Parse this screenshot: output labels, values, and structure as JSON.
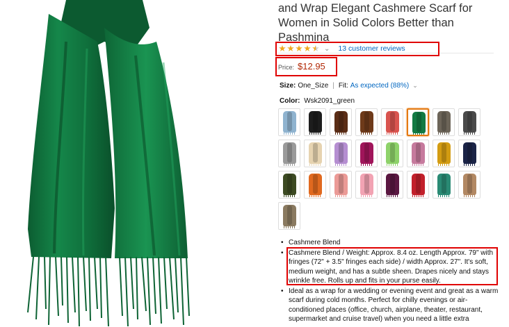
{
  "product": {
    "title": "and Wrap Elegant Cashmere Scarf for Women in Solid Colors Better than Pashmina",
    "rating": {
      "stars": 4.5,
      "reviews_link": "13 customer reviews"
    },
    "price": {
      "label": "Price:",
      "value": "$12.95"
    },
    "size": {
      "label": "Size:",
      "value": "One_Size",
      "fit_label": "Fit:",
      "fit_value": "As expected (88%)"
    },
    "color": {
      "label": "Color:",
      "value": "Wsk2091_green"
    },
    "swatches": [
      {
        "name": "light blue",
        "color": "#8fb3cf",
        "selected": false
      },
      {
        "name": "black",
        "color": "#1d1d1d",
        "selected": false
      },
      {
        "name": "brown",
        "color": "#5a2d16",
        "selected": false
      },
      {
        "name": "chocolate",
        "color": "#6e3a1a",
        "selected": false
      },
      {
        "name": "coral",
        "color": "#d9544f",
        "selected": false
      },
      {
        "name": "green",
        "color": "#127a43",
        "selected": true
      },
      {
        "name": "taupe",
        "color": "#6c6458",
        "selected": false
      },
      {
        "name": "charcoal",
        "color": "#4a4a4a",
        "selected": false
      },
      {
        "name": "grey",
        "color": "#9a9a9a",
        "selected": false
      },
      {
        "name": "beige",
        "color": "#e6d3b0",
        "selected": false
      },
      {
        "name": "lavender",
        "color": "#b58ed1",
        "selected": false
      },
      {
        "name": "magenta",
        "color": "#a0155a",
        "selected": false
      },
      {
        "name": "lime",
        "color": "#8ed26a",
        "selected": false
      },
      {
        "name": "mauve",
        "color": "#c67a9d",
        "selected": false
      },
      {
        "name": "mustard",
        "color": "#d39c12",
        "selected": false
      },
      {
        "name": "navy",
        "color": "#1a2346",
        "selected": false
      },
      {
        "name": "olive",
        "color": "#3c4a22",
        "selected": false
      },
      {
        "name": "orange",
        "color": "#e0691f",
        "selected": false
      },
      {
        "name": "peach",
        "color": "#eb9a96",
        "selected": false
      },
      {
        "name": "pink",
        "color": "#f2a3b3",
        "selected": false
      },
      {
        "name": "plum",
        "color": "#5a1741",
        "selected": false
      },
      {
        "name": "red",
        "color": "#c2202b",
        "selected": false
      },
      {
        "name": "teal",
        "color": "#2a8a74",
        "selected": false
      },
      {
        "name": "camel",
        "color": "#b28863",
        "selected": false
      },
      {
        "name": "khaki",
        "color": "#8a7a60",
        "selected": false
      }
    ],
    "bullets": [
      "Cashmere Blend",
      "Cashmere Blend / Weight: Approx. 8.4 oz. Length Approx. 79\" with fringes (72\" + 3.5\" fringes each side) / width Approx. 27\". It's soft, medium weight, and has a subtle sheen. Drapes nicely and stays wrinkle free. Rolls up and fits in your purse easily.",
      "Ideal as a wrap for a wedding or evening event and great as a warm scarf during cold months. Perfect for chilly evenings or air-conditioned places (office, church, airplane, theater, restaurant, supermarket and cruise travel) when you need a little extra"
    ]
  },
  "colors": {
    "link": "#0066c0",
    "price": "#b12704",
    "star": "#f0a81e",
    "highlight": "#e00000",
    "scarf": "#127a43"
  }
}
